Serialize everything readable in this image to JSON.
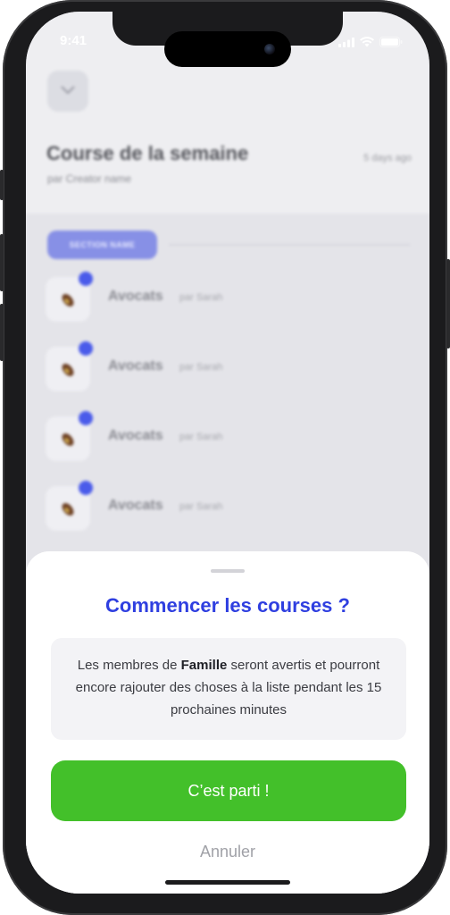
{
  "status": {
    "time": "9:41"
  },
  "header": {
    "title": "Course de la semaine",
    "author": "par Creator name",
    "date": "5 days ago"
  },
  "section": {
    "name": "SECTION NAME"
  },
  "items": [
    {
      "name": "Avocats",
      "by": "par Sarah",
      "icon": "avocado-icon"
    },
    {
      "name": "Avocats",
      "by": "par Sarah",
      "icon": "avocado-icon"
    },
    {
      "name": "Avocats",
      "by": "par Sarah",
      "icon": "avocado-icon"
    },
    {
      "name": "Avocats",
      "by": "par Sarah",
      "icon": "avocado-icon"
    }
  ],
  "sheet": {
    "title": "Commencer les courses ?",
    "info_before": "Les membres de ",
    "info_group": "Famille",
    "info_after": " seront avertis et pourront encore rajouter des choses à la liste pendant les 15 prochaines minutes",
    "confirm_label": "C’est parti !",
    "cancel_label": "Annuler"
  },
  "colors": {
    "accent": "#2f3fe0",
    "confirm": "#43c02a",
    "badge": "#4a5bea"
  }
}
